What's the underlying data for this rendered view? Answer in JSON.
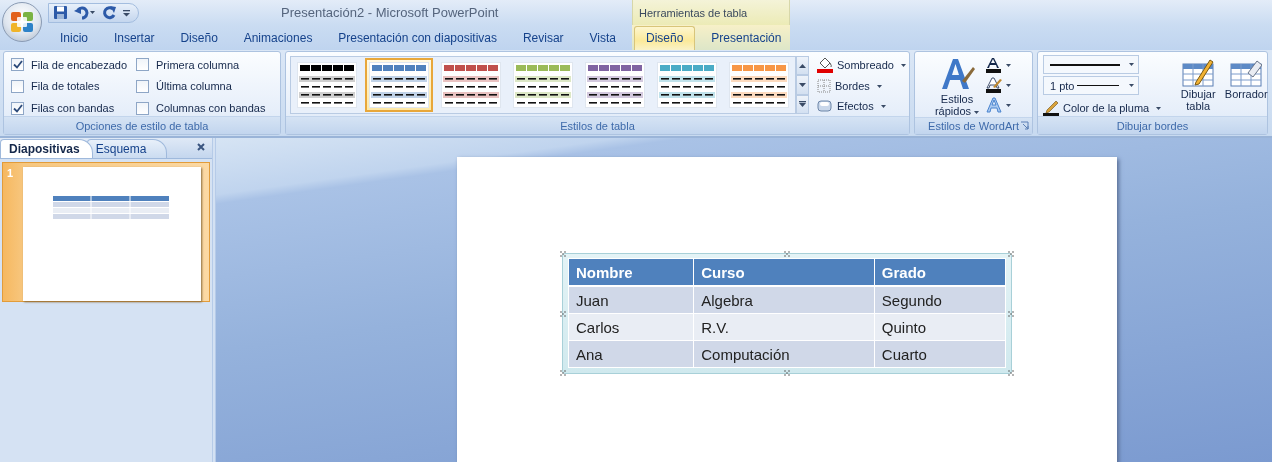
{
  "window": {
    "title": "Presentación2 - Microsoft PowerPoint"
  },
  "contextual_group": "Herramientas de tabla",
  "tabs": [
    {
      "label": "Inicio",
      "selected": false,
      "contextual": false
    },
    {
      "label": "Insertar",
      "selected": false,
      "contextual": false
    },
    {
      "label": "Diseño",
      "selected": false,
      "contextual": false
    },
    {
      "label": "Animaciones",
      "selected": false,
      "contextual": false
    },
    {
      "label": "Presentación con diapositivas",
      "selected": false,
      "contextual": false
    },
    {
      "label": "Revisar",
      "selected": false,
      "contextual": false
    },
    {
      "label": "Vista",
      "selected": false,
      "contextual": false
    },
    {
      "label": "Diseño",
      "selected": true,
      "contextual": true
    },
    {
      "label": "Presentación",
      "selected": false,
      "contextual": true
    }
  ],
  "style_options": {
    "title": "Opciones de estilo de tabla",
    "options": [
      {
        "label": "Fila de encabezado",
        "checked": true
      },
      {
        "label": "Primera columna",
        "checked": false
      },
      {
        "label": "Fila de totales",
        "checked": false
      },
      {
        "label": "Última columna",
        "checked": false
      },
      {
        "label": "Filas con bandas",
        "checked": true
      },
      {
        "label": "Columnas con bandas",
        "checked": false
      }
    ]
  },
  "table_styles": {
    "title": "Estilos de tabla",
    "styles": [
      {
        "color": "#000000",
        "selected": false
      },
      {
        "color": "#4f81bd",
        "selected": true
      },
      {
        "color": "#c0504d",
        "selected": false
      },
      {
        "color": "#9bbb59",
        "selected": false
      },
      {
        "color": "#8064a2",
        "selected": false
      },
      {
        "color": "#4bacc6",
        "selected": false
      },
      {
        "color": "#f79646",
        "selected": false
      }
    ],
    "commands": [
      {
        "label": "Sombreado",
        "kind": "shading"
      },
      {
        "label": "Bordes",
        "kind": "borders"
      },
      {
        "label": "Efectos",
        "kind": "effects"
      }
    ]
  },
  "wordart": {
    "title": "Estilos de WordArt",
    "quick_styles": "Estilos rápidos"
  },
  "draw_borders": {
    "title": "Dibujar bordes",
    "pen_weight": "1 pto",
    "pen_color": "Color de la pluma",
    "tools": [
      {
        "label": "Dibujar tabla",
        "kind": "draw"
      },
      {
        "label": "Borrador",
        "kind": "eraser"
      }
    ]
  },
  "slide_panel": {
    "tabs": [
      {
        "label": "Diapositivas",
        "selected": true
      },
      {
        "label": "Esquema",
        "selected": false
      }
    ],
    "slides": [
      {
        "number": "1",
        "selected": true
      }
    ]
  },
  "slide": {
    "table": {
      "columns": [
        "Nombre",
        "Curso",
        "Grado"
      ],
      "rows": [
        [
          "Juan",
          "Algebra",
          "Segundo"
        ],
        [
          "Carlos",
          "R.V.",
          "Quinto"
        ],
        [
          "Ana",
          "Computación",
          "Cuarto"
        ]
      ]
    }
  }
}
